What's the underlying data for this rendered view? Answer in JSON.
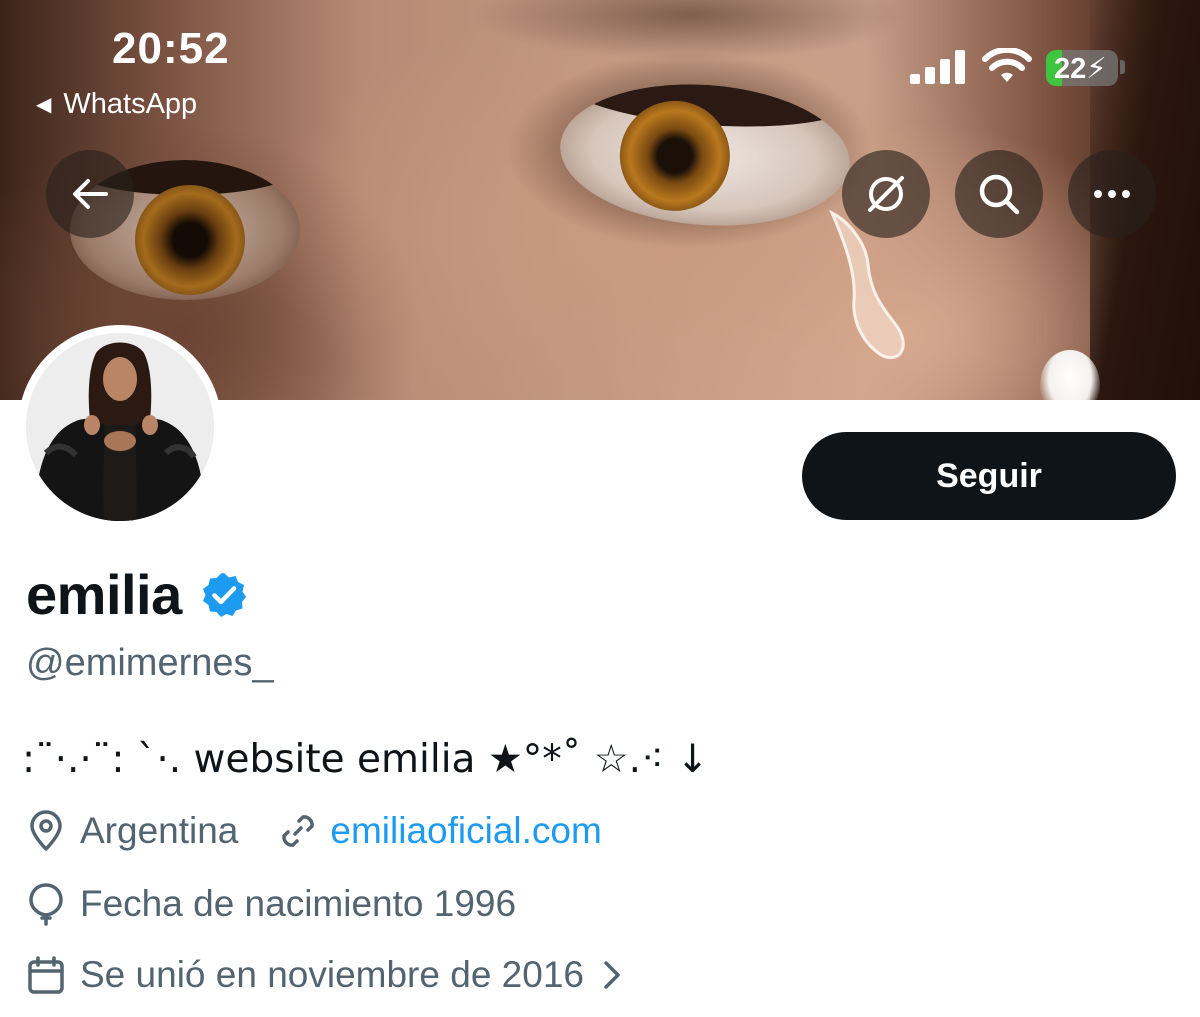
{
  "status_bar": {
    "time": "20:52",
    "back_app": "WhatsApp",
    "battery": "22",
    "battery_level": 0.22
  },
  "header": {
    "back_icon": "arrow-left-icon",
    "grok_icon": "grok-icon",
    "search_icon": "search-icon",
    "more_icon": "more-horizontal-icon"
  },
  "profile": {
    "display_name": "emilia",
    "handle": "@emimernes_",
    "bio": ":¨·.·¨: `·. website emilia ★°*˚ ☆.⁖ ↓",
    "location": "Argentina",
    "website": "emiliaoficial.com",
    "birth": "Fecha de nacimiento 1996",
    "joined": "Se unió en noviembre de 2016"
  },
  "actions": {
    "follow_label": "Seguir"
  },
  "colors": {
    "primary_text": "#0f1419",
    "secondary_text": "#536471",
    "link": "#1d9bf0",
    "verified": "#1d9bf0",
    "follow_bg": "#0f1419"
  }
}
